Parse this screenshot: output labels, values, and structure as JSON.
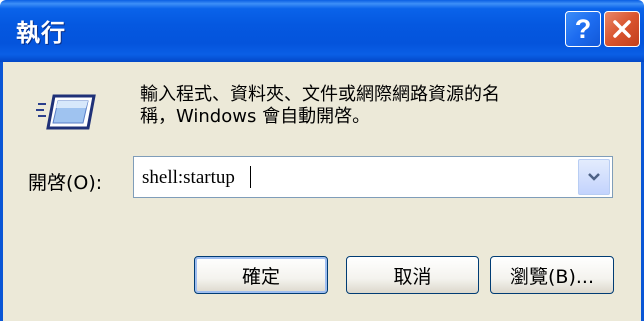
{
  "window": {
    "title": "執行",
    "help_button_glyph": "?",
    "close_icon": "close-icon",
    "colors": {
      "titlebar": "#0454dc",
      "close": "#d9542e",
      "client": "#ece9d8"
    }
  },
  "dialog": {
    "icon": "run-icon",
    "description_line1": "輸入程式、資料夾、文件或網際網路資源的名",
    "description_line2": "稱，Windows 會自動開啓。",
    "open_label": "開啓(O):",
    "open_value": "shell:startup"
  },
  "buttons": {
    "ok": "確定",
    "cancel": "取消",
    "browse": "瀏覽(B)..."
  }
}
